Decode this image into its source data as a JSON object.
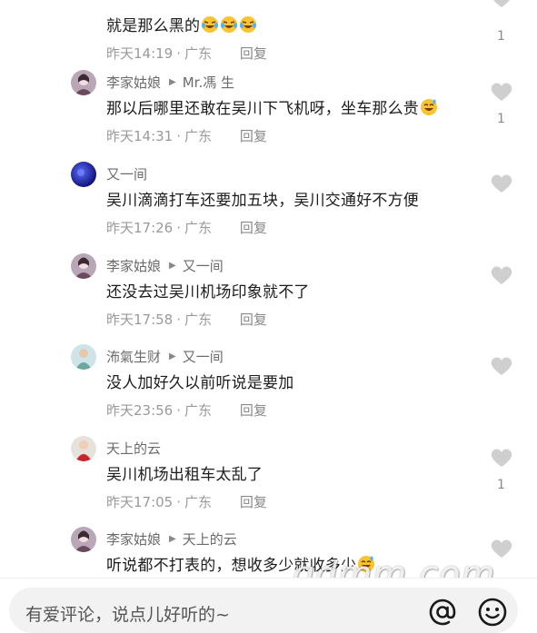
{
  "comments": [
    {
      "user": "",
      "reply_to": "",
      "text": "就是那么黑的",
      "emoji": [
        "laugh-cry",
        "laugh-cry",
        "laugh-cry"
      ],
      "time": "昨天14:19",
      "location": "广东",
      "reply_label": "回复",
      "likes": "1"
    },
    {
      "user": "李家姑娘",
      "reply_to": "Mr.馮 生",
      "text": "那以后哪里还敢在吴川下飞机呀，坐车那么贵",
      "emoji": [
        "sweat-laugh"
      ],
      "time": "昨天14:31",
      "location": "广东",
      "reply_label": "回复",
      "likes": "1"
    },
    {
      "user": "又一间",
      "reply_to": "",
      "text": "吴川滴滴打车还要加五块，吴川交通好不方便",
      "emoji": [],
      "time": "昨天17:26",
      "location": "广东",
      "reply_label": "回复",
      "likes": ""
    },
    {
      "user": "李家姑娘",
      "reply_to": "又一间",
      "text": "还没去过吴川机场印象就不了",
      "emoji": [],
      "time": "昨天17:58",
      "location": "广东",
      "reply_label": "回复",
      "likes": ""
    },
    {
      "user": "㳍氣生财",
      "reply_to": "又一间",
      "text": "没人加好久以前听说是要加",
      "emoji": [],
      "time": "昨天23:56",
      "location": "广东",
      "reply_label": "回复",
      "likes": ""
    },
    {
      "user": "天上的云",
      "reply_to": "",
      "text": "吴川机场出租车太乱了",
      "emoji": [],
      "time": "昨天17:05",
      "location": "广东",
      "reply_label": "回复",
      "likes": "1"
    },
    {
      "user": "李家姑娘",
      "reply_to": "天上的云",
      "text": "听说都不打表的，想收多少就收多少",
      "emoji": [
        "sweat-laugh"
      ],
      "time": "",
      "location": "",
      "reply_label": "",
      "likes": ""
    }
  ],
  "input": {
    "placeholder": "有爱评论，说点儿好听的~"
  },
  "icons": {
    "at": "at-icon",
    "emoji": "emoji-face-icon",
    "like": "heart-icon"
  },
  "watermark": "gdmm.com",
  "colors": {
    "heart": "#cfcfcf",
    "meta": "#9a9a9a",
    "input_bg": "#f2f2f2"
  }
}
